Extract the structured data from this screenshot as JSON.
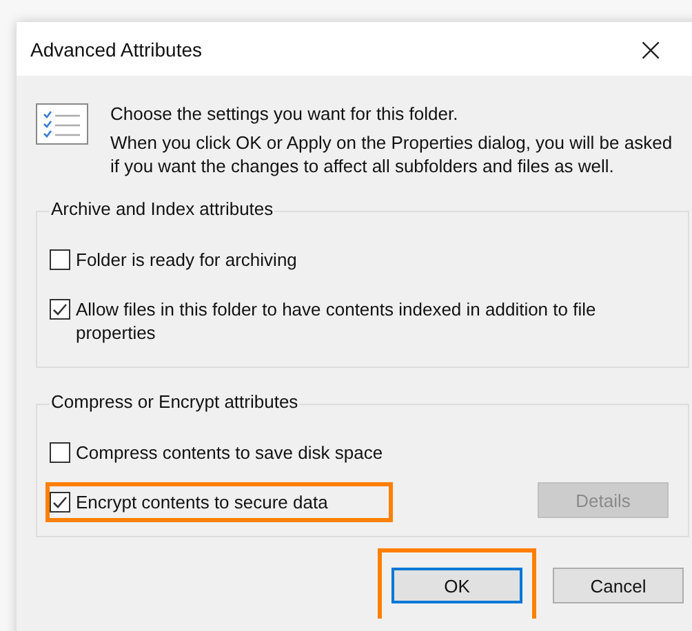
{
  "window": {
    "title": "Advanced Attributes",
    "close": "×"
  },
  "intro": {
    "heading": "Choose the settings you want for this folder.",
    "text": "When you click OK or Apply on the Properties dialog, you will be asked if you want the changes to affect all subfolders and files as well."
  },
  "groups": [
    {
      "title": "Archive and Index attributes",
      "items": [
        {
          "kind": "checkbox",
          "label": "Folder is ready for archiving",
          "checked": false,
          "highlighted": false
        },
        {
          "kind": "checkbox",
          "label": "Allow files in this folder to have contents indexed in addition to file properties",
          "checked": true,
          "highlighted": false
        }
      ]
    },
    {
      "title": "Compress or Encrypt attributes",
      "items": [
        {
          "kind": "checkbox",
          "label": "Compress contents to save disk space",
          "checked": false,
          "highlighted": false
        },
        {
          "kind": "checkbox",
          "label": "Encrypt contents to secure data",
          "checked": true,
          "highlighted": true
        }
      ],
      "button": {
        "label": "Details",
        "disabled": true
      }
    }
  ],
  "buttons": [
    {
      "label": "OK",
      "default": true,
      "highlighted": true
    },
    {
      "label": "Cancel",
      "default": false,
      "highlighted": false
    }
  ]
}
